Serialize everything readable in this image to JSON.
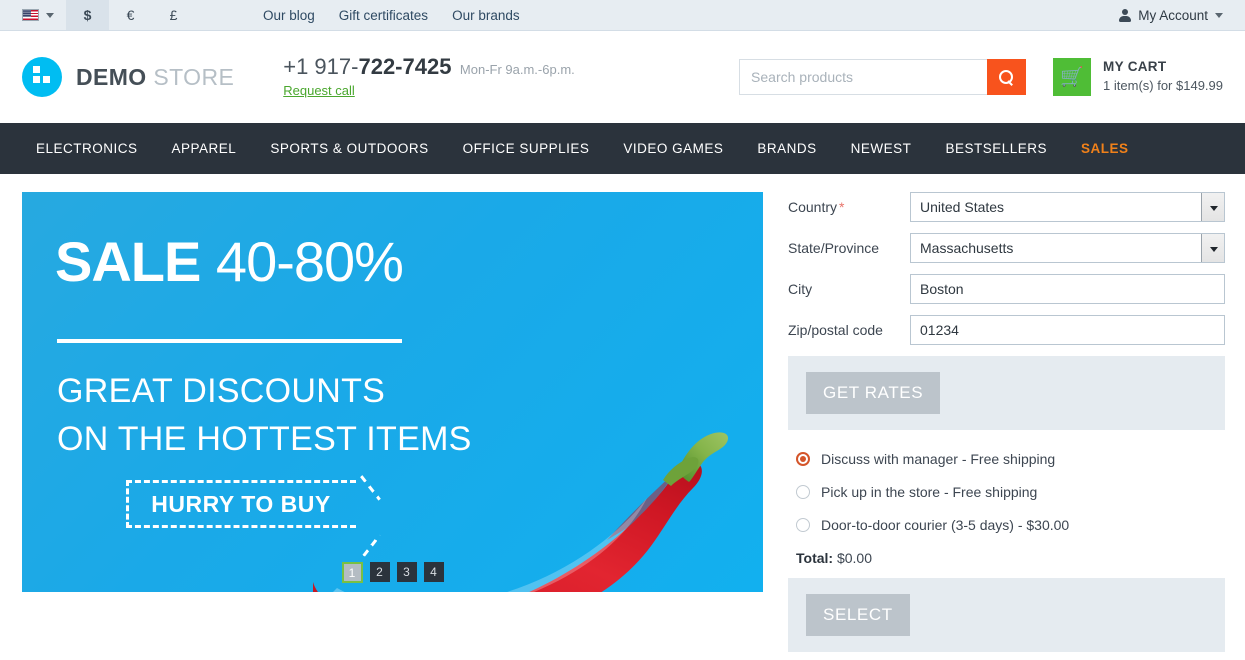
{
  "topbar": {
    "flag_icon": "us-flag-icon",
    "lang_caret_icon": "chevron-down-icon",
    "currencies": [
      {
        "symbol": "$",
        "active": true
      },
      {
        "symbol": "€",
        "active": false
      },
      {
        "symbol": "£",
        "active": false
      }
    ],
    "links": [
      "Our blog",
      "Gift certificates",
      "Our brands"
    ],
    "account_icon": "user-icon",
    "account_label": "My Account",
    "account_caret_icon": "chevron-down-icon"
  },
  "header": {
    "logo_icon": "squares-logo-icon",
    "logo_bold": "DEMO",
    "logo_light": "STORE",
    "phone_prefix": "+1 917-",
    "phone_bold": "722-7425",
    "hours": "Mon-Fr 9a.m.-6p.m.",
    "request_call": "Request call",
    "search_placeholder": "Search products",
    "search_value": "",
    "search_icon": "search-icon",
    "cart_icon": "shopping-cart-icon",
    "cart_title": "MY CART",
    "cart_subtitle": "1 item(s) for $149.99"
  },
  "nav": {
    "items": [
      {
        "label": "ELECTRONICS",
        "sale": false
      },
      {
        "label": "APPAREL",
        "sale": false
      },
      {
        "label": "SPORTS & OUTDOORS",
        "sale": false
      },
      {
        "label": "OFFICE SUPPLIES",
        "sale": false
      },
      {
        "label": "VIDEO GAMES",
        "sale": false
      },
      {
        "label": "BRANDS",
        "sale": false
      },
      {
        "label": "NEWEST",
        "sale": false
      },
      {
        "label": "BESTSELLERS",
        "sale": false
      },
      {
        "label": "SALES",
        "sale": true
      }
    ]
  },
  "banner": {
    "headline_strong": "SALE",
    "headline_light": "40-80%",
    "subline1": "GREAT DISCOUNTS",
    "subline2": "ON THE HOTTEST ITEMS",
    "cta": "HURRY TO BUY",
    "image_icon": "red-chili-pepper-image",
    "slides": [
      {
        "label": "1",
        "active": true
      },
      {
        "label": "2",
        "active": false
      },
      {
        "label": "3",
        "active": false
      },
      {
        "label": "4",
        "active": false
      }
    ]
  },
  "shipping": {
    "fields": [
      {
        "label": "Country",
        "required": true,
        "type": "select",
        "value": "United States"
      },
      {
        "label": "State/Province",
        "required": false,
        "type": "select",
        "value": "Massachusetts"
      },
      {
        "label": "City",
        "required": false,
        "type": "text",
        "value": "Boston"
      },
      {
        "label": "Zip/postal code",
        "required": false,
        "type": "text",
        "value": "01234"
      }
    ],
    "get_rates_label": "GET RATES",
    "options": [
      {
        "label": "Discuss with manager - Free shipping",
        "checked": true
      },
      {
        "label": "Pick up in the store - Free shipping",
        "checked": false
      },
      {
        "label": "Door-to-door courier (3-5 days) - $30.00",
        "checked": false
      }
    ],
    "total_label": "Total:",
    "total_value": "$0.00",
    "select_label": "SELECT"
  },
  "colors": {
    "accent_orange": "#f8531d",
    "sale_orange": "#f0811a",
    "cart_green": "#4fbd36",
    "link_green": "#4aa72e",
    "banner_blue": "#1aa9e8",
    "nav_dark": "#2b333c",
    "radio_selected": "#d4552a",
    "panel_gray": "#e5ebf0",
    "disabled_button": "#bcc4cb"
  }
}
